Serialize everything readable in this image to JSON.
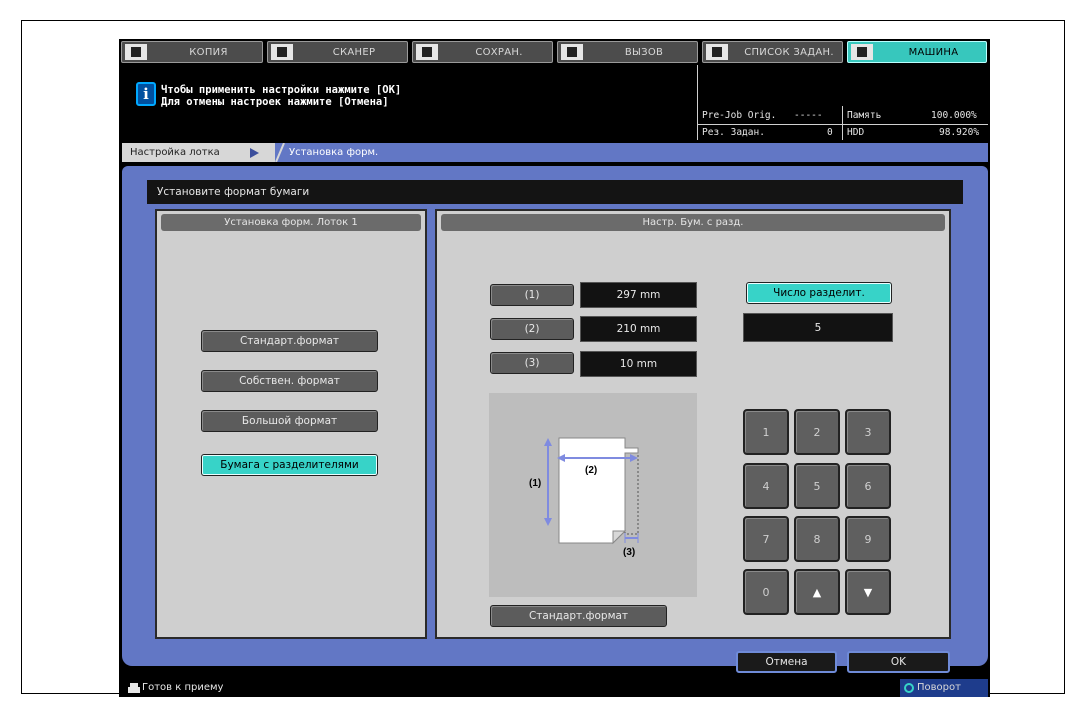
{
  "tabs": [
    {
      "label": "КОПИЯ",
      "icon": "copy-icon"
    },
    {
      "label": "СКАНЕР",
      "icon": "scanner-icon"
    },
    {
      "label": "СОХРАН.",
      "icon": "save-icon"
    },
    {
      "label": "ВЫЗОВ",
      "icon": "recall-icon"
    },
    {
      "label": "СПИСОК ЗАДАН.",
      "icon": "job-list-icon"
    },
    {
      "label": "МАШИНА",
      "icon": "machine-icon"
    }
  ],
  "message": {
    "line1": "Чтобы применить настройки нажмите [OK]",
    "line2": "Для отмены настроек нажмите [Отмена]"
  },
  "status": {
    "prejob_label": "Pre-Job Orig.",
    "prejob_value": "-----",
    "jobs_label": "Рез. Задан.",
    "jobs_value": "0",
    "memory_label": "Память",
    "memory_value": "100.000%",
    "hdd_label": "HDD",
    "hdd_value": "98.920%"
  },
  "breadcrumb": {
    "item1": "Настройка лотка",
    "item2": "Установка форм."
  },
  "title": "Установите формат бумаги",
  "left_panel": {
    "header": "Установка форм.   Лоток 1",
    "buttons": [
      "Стандарт.формат",
      "Собствен. формат",
      "Большой формат",
      "Бумага с разделителями"
    ]
  },
  "right_panel": {
    "header": "Настр. Бум. с разд.",
    "dims": [
      {
        "label": "(1)",
        "value": "297  mm"
      },
      {
        "label": "(2)",
        "value": "210  mm"
      },
      {
        "label": "(3)",
        "value": "10  mm"
      }
    ],
    "count_label": "Число разделит.",
    "count_value": "5",
    "diagram_labels": [
      "(1)",
      "(2)",
      "(3)"
    ],
    "standard_button": "Стандарт.формат",
    "keypad": [
      "1",
      "2",
      "3",
      "4",
      "5",
      "6",
      "7",
      "8",
      "9",
      "0",
      "▲",
      "▼"
    ]
  },
  "actions": {
    "cancel": "Отмена",
    "ok": "OK"
  },
  "footer": {
    "status": "Готов к приему",
    "rotate": "Поворот"
  },
  "colors": {
    "accent": "#37d3c8",
    "panel_blue": "#6277c5"
  }
}
